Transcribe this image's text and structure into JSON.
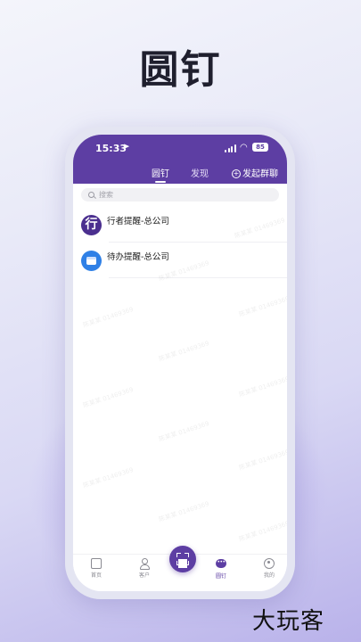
{
  "headline": "圆钉",
  "status_bar": {
    "time": "15:33",
    "battery": "85"
  },
  "header_tabs": {
    "active": "圆钉",
    "discover": "发现",
    "group_chat": "发起群聊"
  },
  "search": {
    "placeholder": "搜索"
  },
  "conversations": [
    {
      "title": "行者提醒-总公司",
      "avatar_text": "行",
      "avatar_color": "#4b2f8f",
      "avatar_icon": "text-avatar"
    },
    {
      "title": "待办提醒-总公司",
      "avatar_color": "#2f80e6",
      "avatar_icon": "calendar-icon"
    }
  ],
  "watermark_text": "陈某某 01469369",
  "bottom_nav": {
    "items": [
      {
        "label": "首页",
        "icon": "home-icon"
      },
      {
        "label": "客户",
        "icon": "customer-icon"
      },
      {
        "label": "",
        "icon": "scan-icon"
      },
      {
        "label": "圆钉",
        "icon": "chat-icon",
        "active": true
      },
      {
        "label": "我的",
        "icon": "profile-icon"
      }
    ]
  },
  "colors": {
    "brand_purple": "#5d3ea3",
    "accent_blue": "#2f80e6"
  },
  "footer_brand": "大玩客"
}
